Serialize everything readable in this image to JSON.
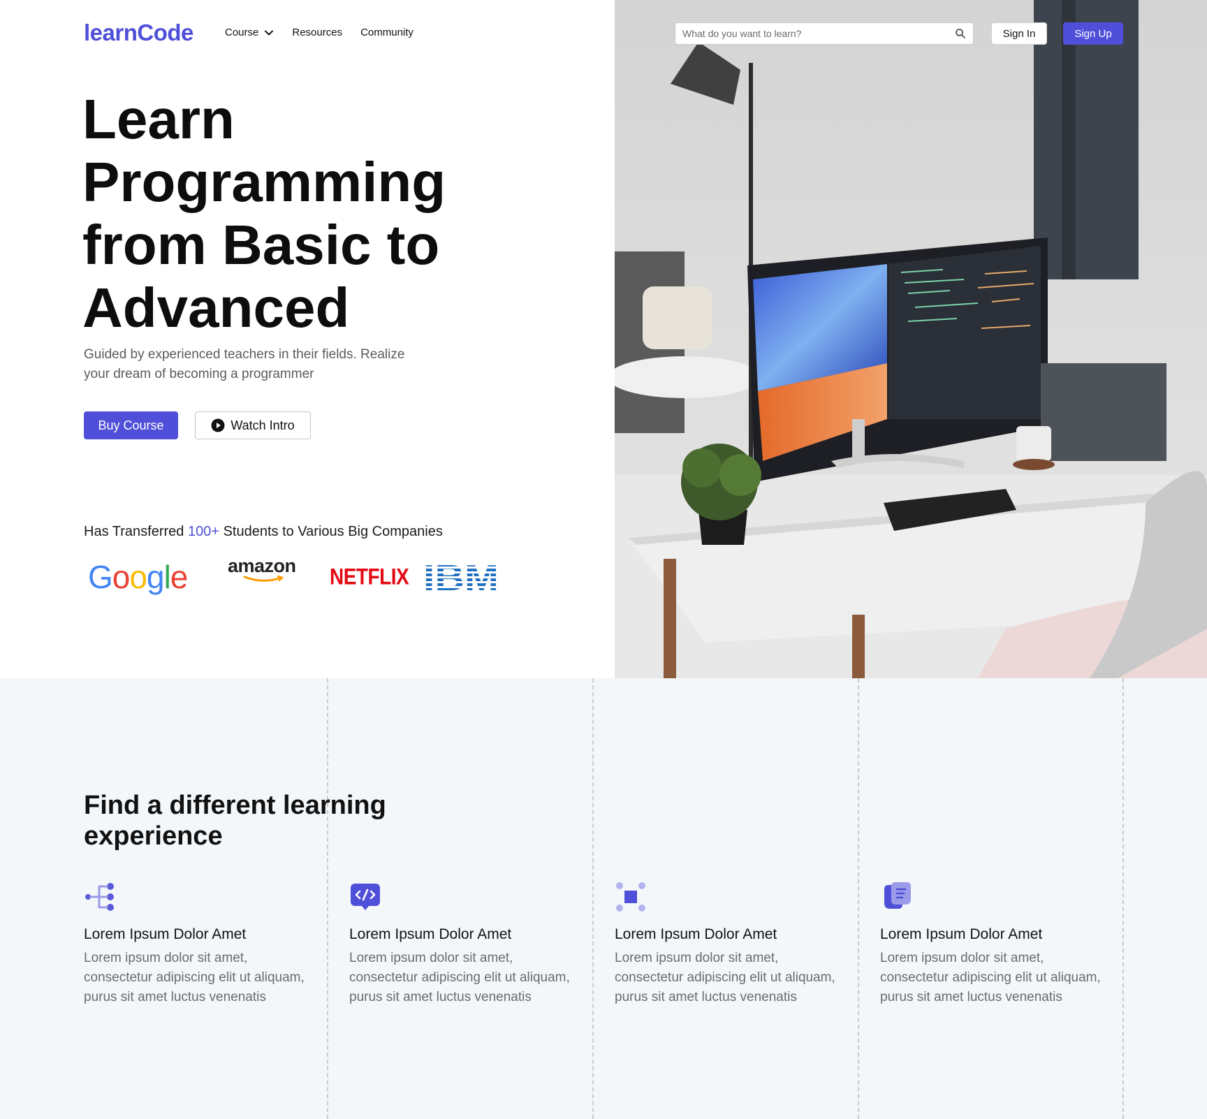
{
  "brand": {
    "logo_text": "learnCode",
    "accent_color": "#4f4fd9"
  },
  "nav": {
    "items": [
      {
        "label": "Course",
        "has_dropdown": true
      },
      {
        "label": "Resources"
      },
      {
        "label": "Community"
      }
    ]
  },
  "header": {
    "search_placeholder": "What do you want to learn?",
    "signin_label": "Sign In",
    "signup_label": "Sign Up"
  },
  "hero": {
    "headline_lines": [
      "Learn",
      "Programming",
      "from Basic to",
      "Advanced"
    ],
    "subtext_line1": "Guided by experienced teachers in their fields. Realize",
    "subtext_line2": "your dream of becoming a programmer",
    "buy_label": "Buy Course",
    "watch_label": "Watch Intro",
    "transferred_prefix": "Has Transferred ",
    "transferred_count": "100+",
    "transferred_suffix": " Students to Various Big Companies",
    "companies": [
      "Google",
      "amazon",
      "NETFLIX",
      "IBM"
    ]
  },
  "features": {
    "title_line1": "Find a different learning",
    "title_line2": "experience",
    "items": [
      {
        "icon": "hierarchy-icon",
        "title": "Lorem Ipsum Dolor Amet",
        "desc_line1": "Lorem ipsum dolor sit amet,",
        "desc_line2": "consectetur adipiscing elit ut aliquam,",
        "desc_line3": "purus sit amet luctus venenatis"
      },
      {
        "icon": "code-chat-icon",
        "title": "Lorem Ipsum Dolor Amet",
        "desc_line1": "Lorem ipsum dolor sit amet,",
        "desc_line2": "consectetur adipiscing elit ut aliquam,",
        "desc_line3": "purus sit amet luctus venenatis"
      },
      {
        "icon": "nodes-icon",
        "title": "Lorem Ipsum Dolor Amet",
        "desc_line1": "Lorem ipsum dolor sit amet,",
        "desc_line2": "consectetur adipiscing elit ut aliquam,",
        "desc_line3": "purus sit amet luctus venenatis"
      },
      {
        "icon": "notes-icon",
        "title": "Lorem Ipsum Dolor Amet",
        "desc_line1": "Lorem ipsum dolor sit amet,",
        "desc_line2": "consectetur adipiscing elit ut aliquam,",
        "desc_line3": "purus sit amet luctus venenatis"
      }
    ]
  }
}
